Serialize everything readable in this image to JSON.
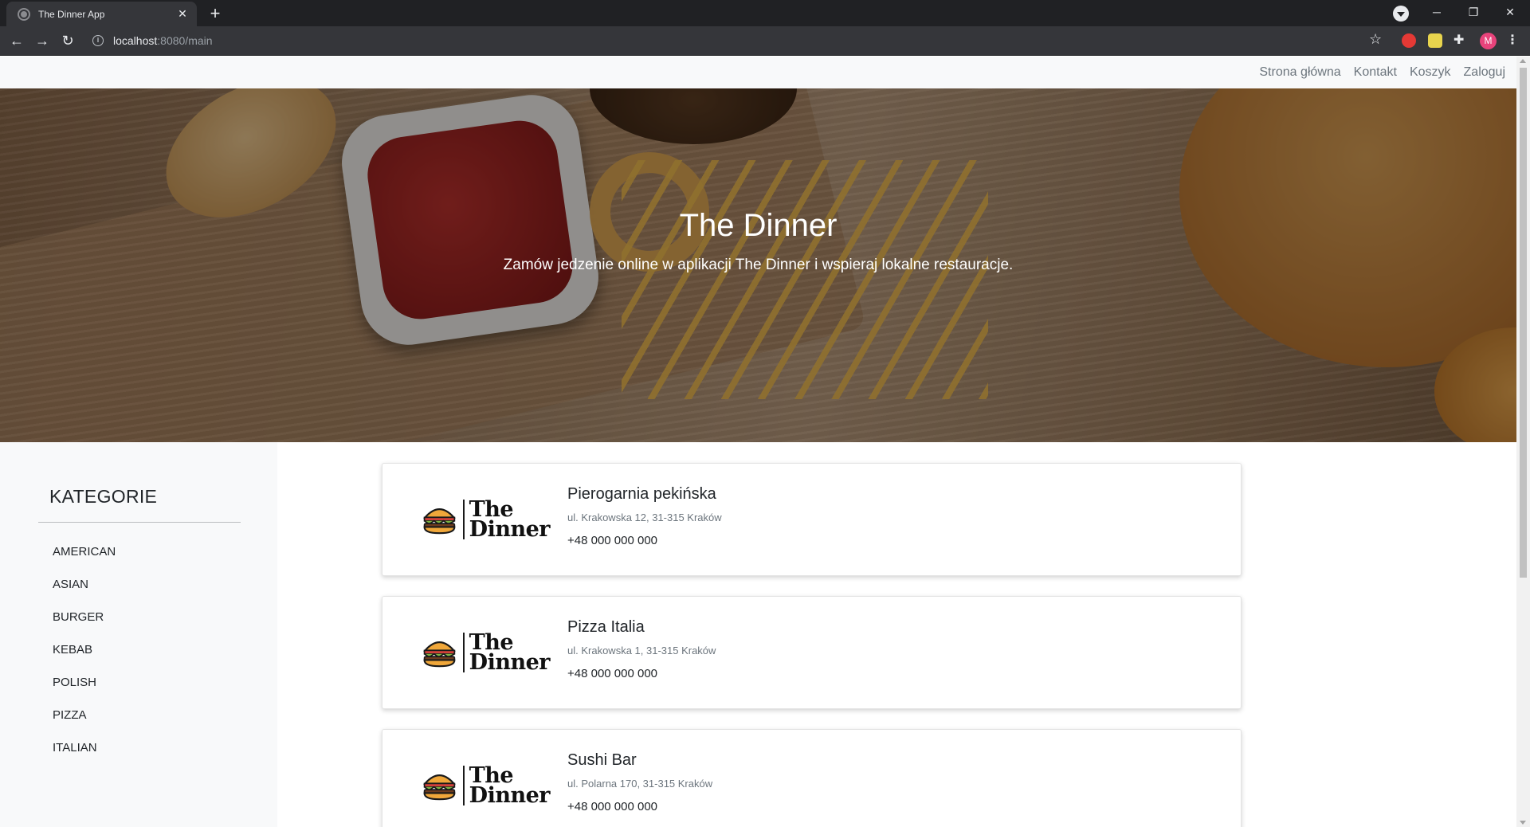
{
  "browser": {
    "tab_title": "The Dinner App",
    "tab_close": "✕",
    "new_tab": "+",
    "url_host": "localhost",
    "url_rest": ":8080/main",
    "window_controls": {
      "minimize": "─",
      "restore": "❐",
      "close": "✕"
    },
    "profile_initial": "M"
  },
  "navbar": {
    "links": [
      "Strona główna",
      "Kontakt",
      "Koszyk",
      "Zaloguj"
    ]
  },
  "hero": {
    "title": "The Dinner",
    "subtitle": "Zamów jedzenie online w aplikacji The Dinner i wspieraj lokalne restauracje."
  },
  "sidebar": {
    "title": "KATEGORIE",
    "categories": [
      "AMERICAN",
      "ASIAN",
      "BURGER",
      "KEBAB",
      "POLISH",
      "PIZZA",
      "ITALIAN"
    ]
  },
  "restaurants": [
    {
      "name": "Pierogarnia pekińska",
      "address": "ul. Krakowska 12, 31-315 Kraków",
      "phone": "+48 000 000 000"
    },
    {
      "name": "Pizza Italia",
      "address": "ul. Krakowska 1, 31-315 Kraków",
      "phone": "+48 000 000 000"
    },
    {
      "name": "Sushi Bar",
      "address": "ul. Polarna 170, 31-315 Kraków",
      "phone": "+48 000 000 000"
    }
  ],
  "logo": {
    "line1": "The",
    "line2": "Dinner"
  },
  "colors": {
    "navbar_bg": "#f8f9fa",
    "link": "#6c757d",
    "text": "#212529",
    "muted": "#6c757d"
  }
}
